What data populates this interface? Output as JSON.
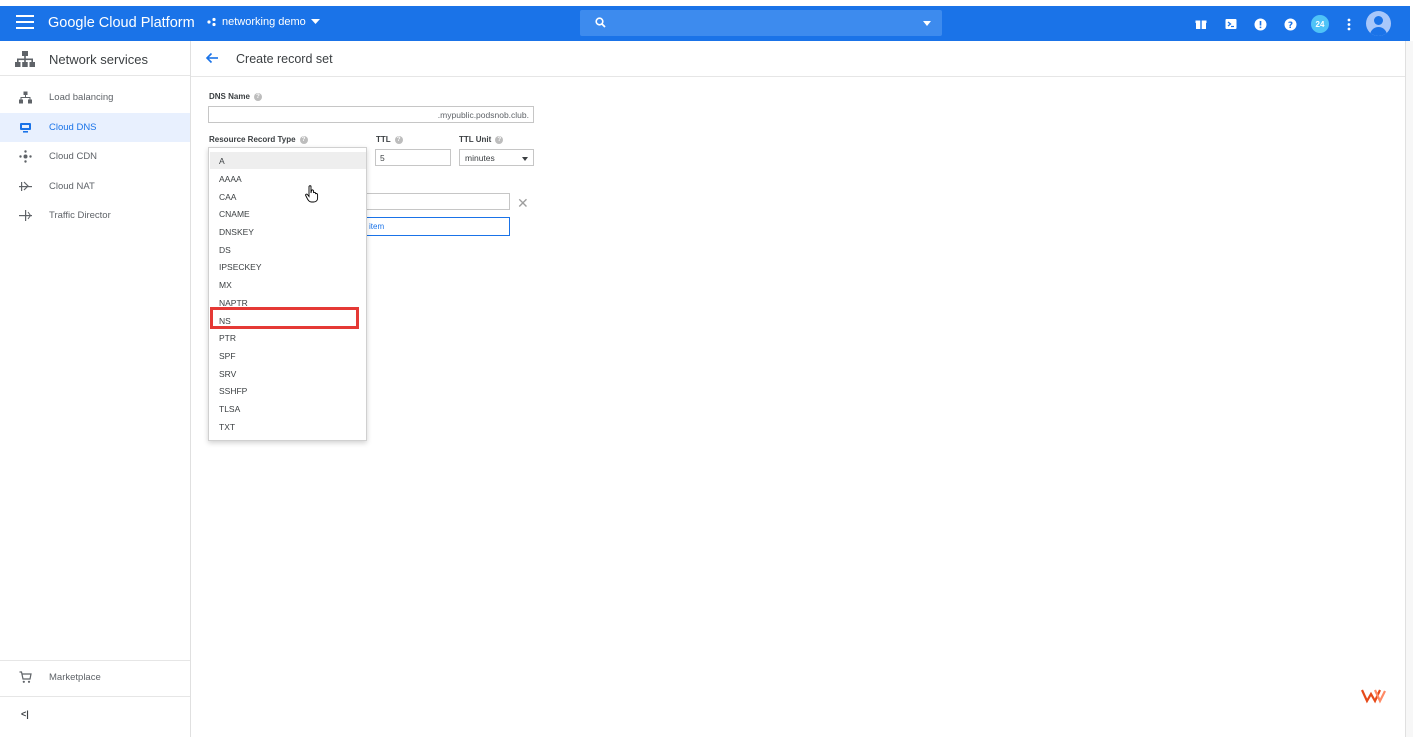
{
  "appbar": {
    "brand": "Google Cloud Platform",
    "project": "networking demo",
    "notification_count": "24",
    "icons": [
      "gift-icon",
      "cloud-shell-icon",
      "notifications-icon",
      "help-icon",
      "more-vert-icon"
    ]
  },
  "sidebar": {
    "section_title": "Network services",
    "items": [
      {
        "label": "Load balancing",
        "icon": "load-balancing-icon"
      },
      {
        "label": "Cloud DNS",
        "icon": "cloud-dns-icon"
      },
      {
        "label": "Cloud CDN",
        "icon": "cloud-cdn-icon"
      },
      {
        "label": "Cloud NAT",
        "icon": "cloud-nat-icon"
      },
      {
        "label": "Traffic Director",
        "icon": "traffic-director-icon"
      }
    ],
    "marketplace": "Marketplace",
    "collapse": "<|"
  },
  "header": {
    "title": "Create record set"
  },
  "form": {
    "dns_name_label": "DNS Name",
    "dns_name_suffix": ".mypublic.podsnob.club.",
    "record_type_label": "Resource Record Type",
    "ttl_label": "TTL",
    "ttl_value": "5",
    "ttl_unit_label": "TTL Unit",
    "ttl_unit_value": "minutes",
    "add_item": "item"
  },
  "dropdown": {
    "options": [
      "A",
      "AAAA",
      "CAA",
      "CNAME",
      "DNSKEY",
      "DS",
      "IPSECKEY",
      "MX",
      "NAPTR",
      "NS",
      "PTR",
      "SPF",
      "SRV",
      "SSHFP",
      "TLSA",
      "TXT"
    ],
    "hovered": "A",
    "highlighted": "NS"
  },
  "colors": {
    "appbar": "#1a73e8",
    "highlight": "#e53935",
    "active_nav_bg": "#e8f0fe"
  }
}
